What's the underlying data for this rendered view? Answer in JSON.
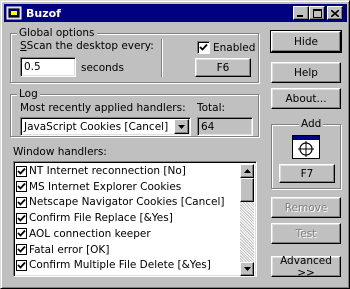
{
  "window": {
    "title": "Buzof",
    "controls": {
      "minimize": "minimize",
      "maximize": "maximize",
      "close": "close"
    }
  },
  "global_options": {
    "title": "Global options",
    "scan_label": "Scan the desktop every:",
    "scan_value": "0.5",
    "scan_unit": "seconds",
    "enabled_label": "Enabled",
    "enabled_checked": true,
    "hotkey_button": "F6"
  },
  "log": {
    "title": "Log",
    "handlers_label": "Most recently applied handlers:",
    "handlers_selected": "JavaScript Cookies [Cancel]",
    "total_label": "Total:",
    "total_value": "64"
  },
  "window_handlers": {
    "title": "Window handlers:",
    "items": [
      {
        "label": "NT Internet reconnection [No]",
        "checked": true
      },
      {
        "label": "MS Internet Explorer Cookies",
        "checked": true
      },
      {
        "label": "Netscape Navigator Cookies [Cancel]",
        "checked": true
      },
      {
        "label": "Confirm File Replace [&Yes]",
        "checked": true
      },
      {
        "label": "AOL connection keeper",
        "checked": true
      },
      {
        "label": "Fatal error [OK]",
        "checked": true
      },
      {
        "label": "Confirm Multiple File Delete [&Yes]",
        "checked": true
      }
    ]
  },
  "buttons": {
    "hide": "Hide",
    "help": "Help",
    "about": "About...",
    "add_title": "Add",
    "add_hotkey": "F7",
    "remove": "Remove",
    "test": "Test",
    "advanced": "Advanced >>"
  },
  "colors": {
    "titlebar": "#000080",
    "face": "#c0c0c0"
  }
}
